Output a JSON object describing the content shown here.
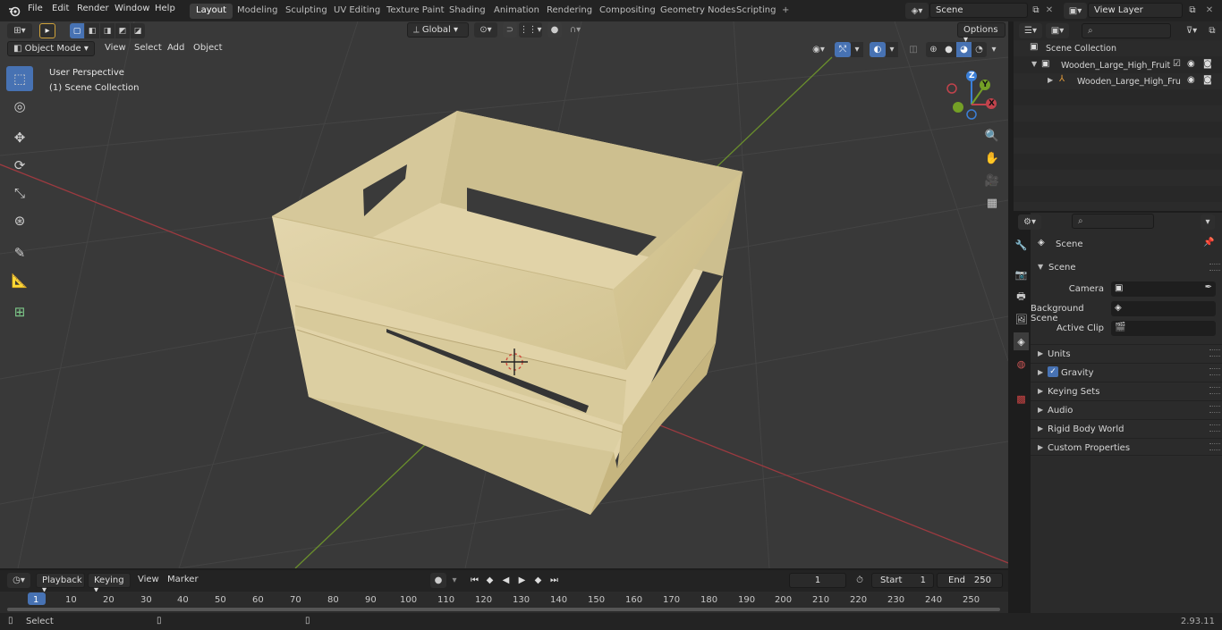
{
  "topbar": {
    "menus": [
      "File",
      "Edit",
      "Render",
      "Window",
      "Help"
    ],
    "workspaces": [
      "Layout",
      "Modeling",
      "Sculpting",
      "UV Editing",
      "Texture Paint",
      "Shading",
      "Animation",
      "Rendering",
      "Compositing",
      "Geometry Nodes",
      "Scripting"
    ],
    "active_workspace": "Layout",
    "add_workspace": "+",
    "scene_name": "Scene",
    "view_layer": "View Layer"
  },
  "viewport": {
    "mode": "Object Mode",
    "menus": [
      "View",
      "Select",
      "Add",
      "Object"
    ],
    "orientation": "Global",
    "options_label": "Options",
    "overlay_title": "User Perspective",
    "overlay_collection": "(1) Scene Collection",
    "gizmo": {
      "z": "Z",
      "y": "Y",
      "x": "X"
    }
  },
  "outliner": {
    "search_placeholder": "",
    "root": "Scene Collection",
    "items": [
      {
        "name": "Wooden_Large_High_Fruit_Bc"
      },
      {
        "name": "Wooden_Large_High_Fru"
      }
    ]
  },
  "properties": {
    "search_placeholder": "",
    "context": "Scene",
    "section": "Scene",
    "fields": [
      {
        "label": "Camera",
        "value": ""
      },
      {
        "label": "Background Scene",
        "value": ""
      },
      {
        "label": "Active Clip",
        "value": ""
      }
    ],
    "panels": [
      "Units",
      "Gravity",
      "Keying Sets",
      "Audio",
      "Rigid Body World",
      "Custom Properties"
    ],
    "gravity_checked": true
  },
  "timeline": {
    "menus": [
      "Playback",
      "Keying",
      "View",
      "Marker"
    ],
    "current_frame": "1",
    "start_label": "Start",
    "start_value": "1",
    "end_label": "End",
    "end_value": "250",
    "ticks": [
      "1",
      "10",
      "20",
      "30",
      "40",
      "50",
      "60",
      "70",
      "80",
      "90",
      "100",
      "110",
      "120",
      "130",
      "140",
      "150",
      "160",
      "170",
      "180",
      "190",
      "200",
      "210",
      "220",
      "230",
      "240",
      "250"
    ]
  },
  "statusbar": {
    "select_label": "Select",
    "version": "2.93.11"
  },
  "colors": {
    "accent": "#4772b3",
    "x_axis": "#c1434c",
    "y_axis": "#74a026",
    "z_axis": "#3b7fd7",
    "wood": "#dccfa4"
  }
}
